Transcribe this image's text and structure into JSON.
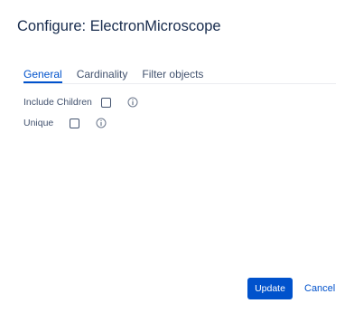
{
  "dialog": {
    "title": "Configure: ElectronMicroscope"
  },
  "tabs": [
    {
      "label": "General",
      "active": true
    },
    {
      "label": "Cardinality",
      "active": false
    },
    {
      "label": "Filter objects",
      "active": false
    }
  ],
  "options": [
    {
      "label": "Include Children",
      "checked": false,
      "icon": "info-icon"
    },
    {
      "label": "Unique",
      "checked": false,
      "icon": "info-icon"
    }
  ],
  "footer": {
    "update_label": "Update",
    "cancel_label": "Cancel"
  },
  "colors": {
    "accent": "#0052cc",
    "text": "#172b4d",
    "muted": "#42526e",
    "divider": "#ebecf0"
  }
}
